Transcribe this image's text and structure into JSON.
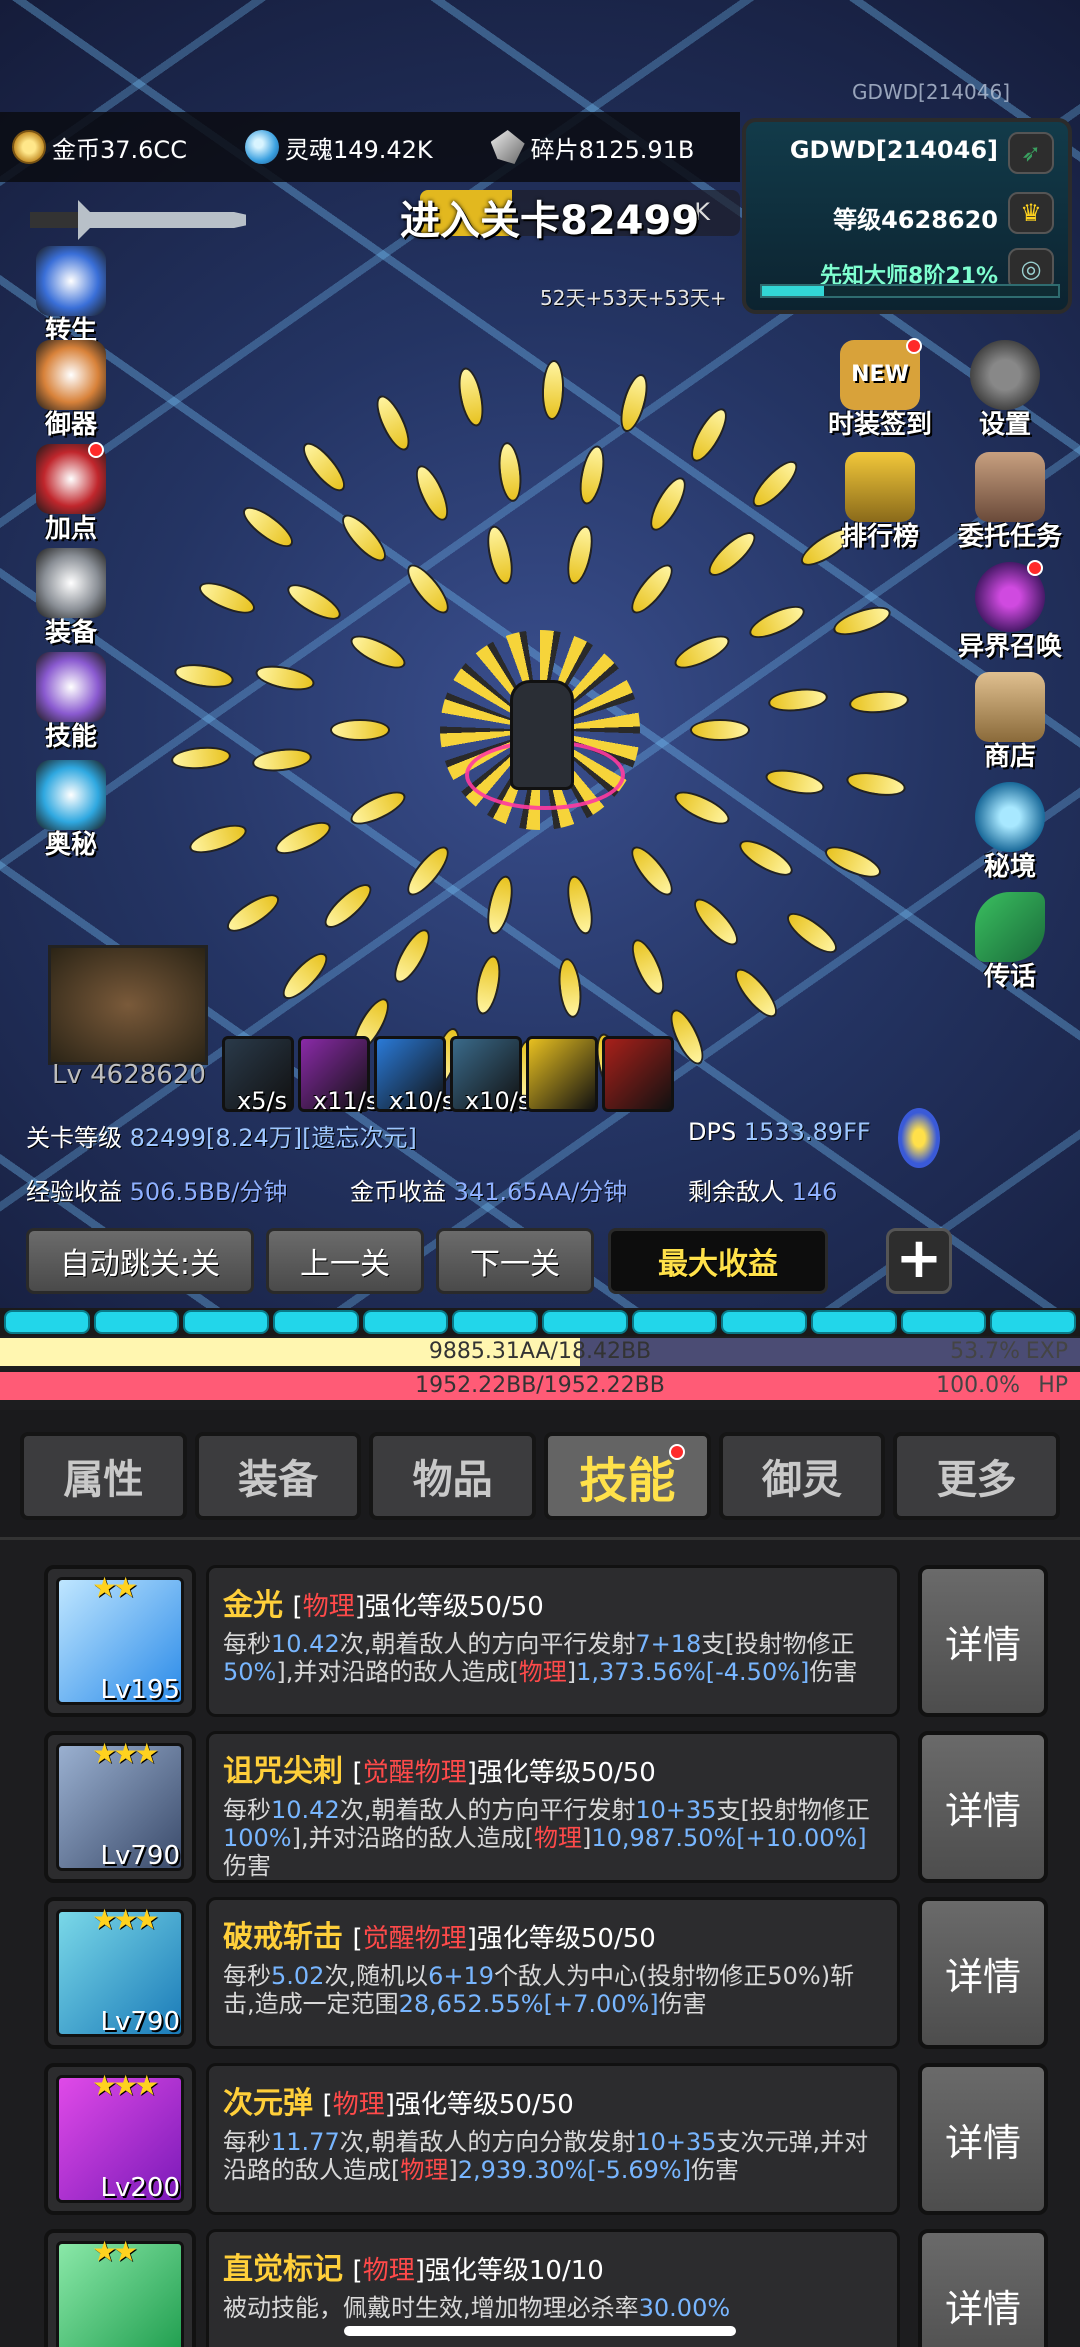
{
  "watermark": "GDWD[214046]",
  "currency": {
    "gold": "金币37.6CC",
    "soul": "灵魂149.42K",
    "shard": "碎片8125.91B"
  },
  "player": {
    "name": "GDWD[214046]",
    "level": "等级4628620",
    "title": "先知大师8阶21%",
    "progress": 0.21
  },
  "stage": {
    "title": "进入关卡82499",
    "behind_text": "K",
    "buff_days": "52天+53天+53天+"
  },
  "left_menu": [
    {
      "label": "转生",
      "color": "#3a6fd8"
    },
    {
      "label": "御器",
      "color": "#d8823a"
    },
    {
      "label": "加点",
      "color": "#c0262c"
    },
    {
      "label": "装备",
      "color": "#8a8f96"
    },
    {
      "label": "技能",
      "color": "#8a5ad0"
    },
    {
      "label": "奥秘",
      "color": "#2fa8e0"
    }
  ],
  "right_menu": [
    {
      "label": "时装签到",
      "badge": "NEW"
    },
    {
      "label": "设置"
    },
    {
      "label": "排行榜"
    },
    {
      "label": "委托任务"
    },
    {
      "label": "异界召唤"
    },
    {
      "label": "商店"
    },
    {
      "label": "秘境"
    },
    {
      "label": "传话"
    }
  ],
  "boss": {
    "level": "Lv 4628620"
  },
  "skill_slots": [
    {
      "rate": "x5/s",
      "color": "#2a3a4a"
    },
    {
      "rate": "x11/s",
      "color": "#8a2aa8"
    },
    {
      "rate": "x10/s",
      "color": "#2a7ad8"
    },
    {
      "rate": "x10/s",
      "color": "#3a6a8a"
    },
    {
      "rate": "",
      "color": "#e8c020"
    },
    {
      "rate": "",
      "color": "#a8201a"
    }
  ],
  "stats": {
    "stage_level_label": "关卡等级",
    "stage_level_value": "82499[8.24万][遗忘次元]",
    "dps_label": "DPS",
    "dps_value": "1533.89FF",
    "exp_label": "经验收益",
    "exp_value": "506.5BB/分钟",
    "gold_label": "金币收益",
    "gold_value": "341.65AA/分钟",
    "enemies_label": "剩余敌人",
    "enemies_value": "146"
  },
  "controls": {
    "auto_skip": "自动跳关:关",
    "prev": "上一关",
    "next": "下一关",
    "max_profit": "最大收益",
    "plus": "+"
  },
  "wave_segments": 12,
  "exp_bar": {
    "text": "9885.31AA/18.42BB",
    "percent": "53.7%",
    "tag": "EXP",
    "fill": 0.537
  },
  "hp_bar": {
    "text": "1952.22BB/1952.22BB",
    "percent": "100.0%",
    "tag": "HP",
    "fill": 1.0
  },
  "tabs": [
    "属性",
    "装备",
    "物品",
    "技能",
    "御灵",
    "更多"
  ],
  "skills": [
    {
      "name": "金光",
      "stars": "★★",
      "level": "Lv195",
      "tag_open": "[",
      "tag_type": "物理",
      "tag_close": "]强化等级50/50",
      "desc": [
        "每秒",
        "10.42",
        "次,朝着敌人的方向平行发射",
        "7+18",
        "支[投射物修正",
        "50%",
        "],并对沿路的敌人造成[",
        "物理",
        "]",
        "1,373.56%[-4.50%]",
        "伤害"
      ],
      "btn": "详情",
      "color1": "#2a8ae8",
      "color2": "#bfe6ff"
    },
    {
      "name": "诅咒尖刺",
      "stars": "★★★",
      "level": "Lv790",
      "tag_open": "[",
      "tag_type": "觉醒物理",
      "tag_close": "]强化等级50/50",
      "desc": [
        "每秒",
        "10.42",
        "次,朝着敌人的方向平行发射",
        "10+35",
        "支[投射物修正",
        "100%",
        "],并对沿路的敌人造成[",
        "物理",
        "]",
        "10,987.50%[+10.00%]",
        "伤害"
      ],
      "btn": "详情",
      "color1": "#3a4a6a",
      "color2": "#9ab0d0"
    },
    {
      "name": "破戒斩击",
      "stars": "★★★",
      "level": "Lv790",
      "tag_open": "[",
      "tag_type": "觉醒物理",
      "tag_close": "]强化等级50/50",
      "desc": [
        "每秒",
        "5.02",
        "次,随机以",
        "6+19",
        "个敌人为中心(投射物修正50%)斩击,造成一定范围",
        "",
        "",
        "",
        "",
        "28,652.55%[+7.00%]",
        "伤害"
      ],
      "btn": "详情",
      "color1": "#1a7ab8",
      "color2": "#7ad8e8"
    },
    {
      "name": "次元弹",
      "stars": "★★★",
      "level": "Lv200",
      "tag_open": "[",
      "tag_type": "物理",
      "tag_close": "]强化等级50/50",
      "desc": [
        "每秒",
        "11.77",
        "次,朝着敌人的方向分散发射",
        "10+35",
        "支次元弹,并对沿路的敌人造成[",
        "",
        "",
        "物理",
        "]",
        "2,939.30%[-5.69%]",
        "伤害"
      ],
      "btn": "详情",
      "color1": "#7a1ab8",
      "color2": "#e04ae8"
    },
    {
      "name": "直觉标记",
      "stars": "★★",
      "level": "",
      "tag_open": "[",
      "tag_type": "物理",
      "tag_close": "]强化等级10/10",
      "desc": [
        "被动技能，佩戴时生效,增加物理必杀率",
        "30.00%",
        "",
        "",
        "",
        "",
        "",
        "",
        "",
        "",
        ""
      ],
      "btn": "详情",
      "color1": "#1a9a4a",
      "color2": "#8ae8a8"
    }
  ]
}
